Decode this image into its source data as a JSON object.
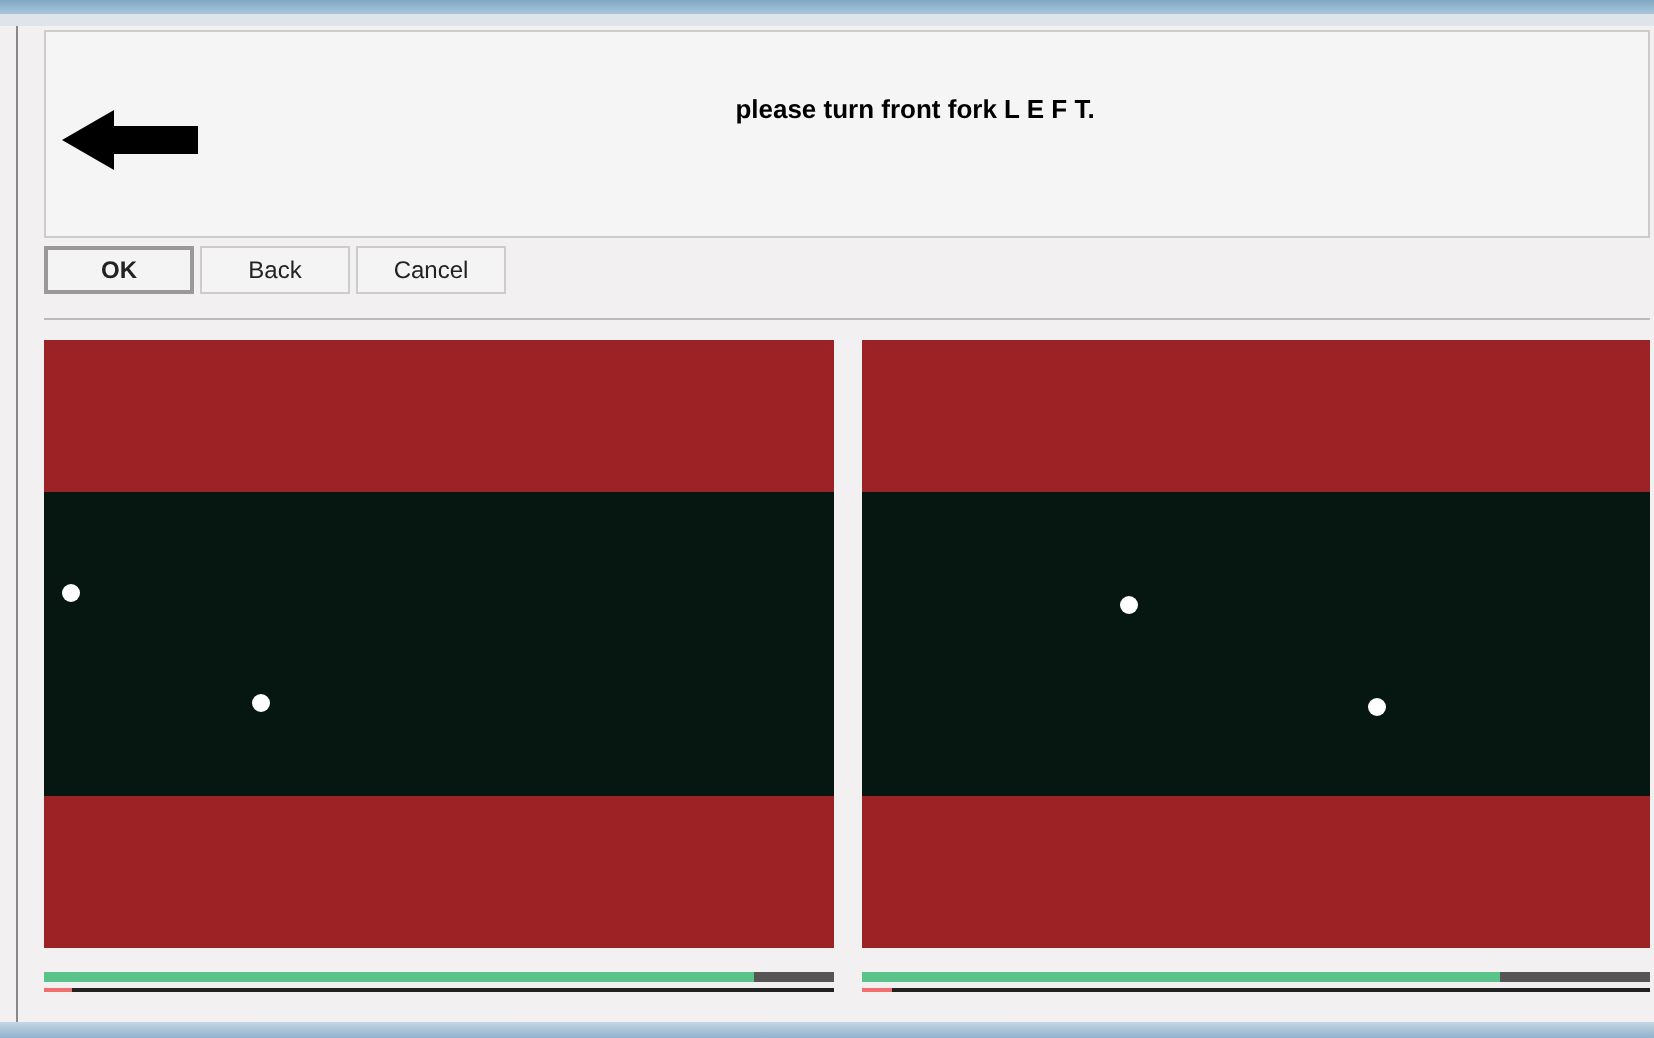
{
  "prompt": {
    "message": "please turn front fork L E F T."
  },
  "buttons": [
    {
      "label": "OK",
      "default": true
    },
    {
      "label": "Back",
      "default": false
    },
    {
      "label": "Cancel",
      "default": false
    }
  ],
  "cameras": [
    {
      "meters": [
        {
          "kind": "green",
          "level": 0.9
        },
        {
          "kind": "red",
          "level": 0.035
        }
      ]
    },
    {
      "meters": [
        {
          "kind": "green",
          "level": 0.81
        },
        {
          "kind": "red",
          "level": 0.04
        }
      ]
    }
  ]
}
